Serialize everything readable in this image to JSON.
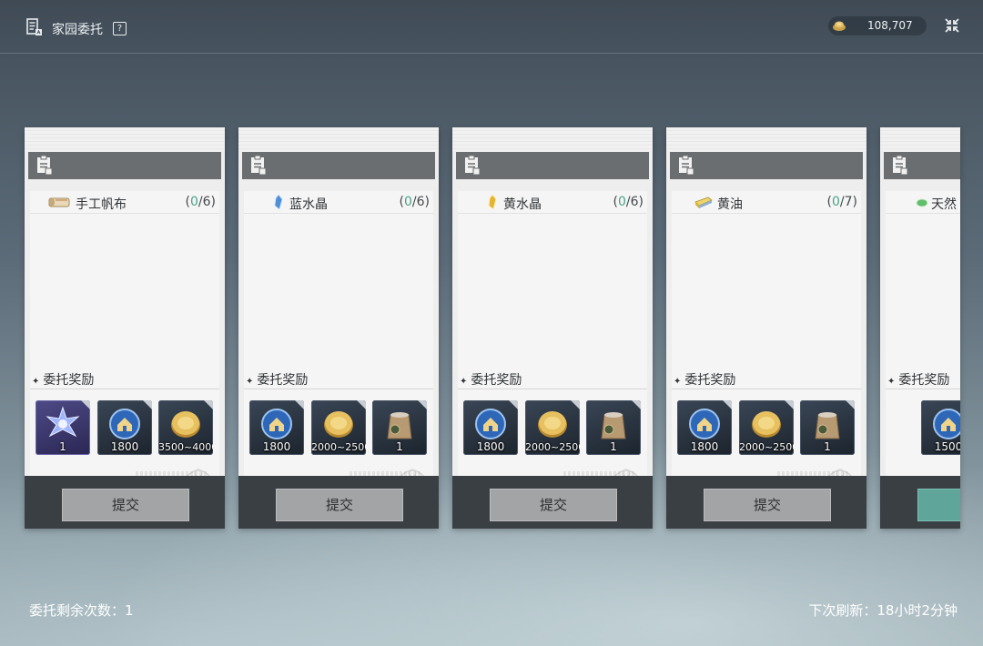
{
  "header": {
    "title": "家园委托",
    "help_icon": "question-icon",
    "currency": {
      "icon": "gold-ingot-icon",
      "value": "108,707"
    },
    "close_icon": "collapse-arrows-icon"
  },
  "cards": [
    {
      "material": {
        "name": "手工帆布",
        "icon": "canvas-roll-icon",
        "current": "0",
        "required": "/6)",
        "open": "("
      },
      "reward_title": "委托奖励",
      "rewards": [
        {
          "icon": "purple-crystal-star-icon",
          "qty": "1",
          "style": "purple"
        },
        {
          "icon": "blue-house-medal-icon",
          "qty": "1800",
          "style": "blue"
        },
        {
          "icon": "gold-coin-icon",
          "qty": "3500~4000",
          "style": "blue"
        }
      ],
      "submit_label": "提交"
    },
    {
      "material": {
        "name": "蓝水晶",
        "icon": "blue-crystal-icon",
        "current": "0",
        "required": "/6)",
        "open": "("
      },
      "reward_title": "委托奖励",
      "rewards": [
        {
          "icon": "blue-house-medal-icon",
          "qty": "1800",
          "style": "blue"
        },
        {
          "icon": "gold-coin-icon",
          "qty": "2000~2500",
          "style": "blue"
        },
        {
          "icon": "seed-sack-icon",
          "qty": "1",
          "style": "blue"
        }
      ],
      "submit_label": "提交"
    },
    {
      "material": {
        "name": "黄水晶",
        "icon": "yellow-crystal-icon",
        "current": "0",
        "required": "/6)",
        "open": "("
      },
      "reward_title": "委托奖励",
      "rewards": [
        {
          "icon": "blue-house-medal-icon",
          "qty": "1800",
          "style": "blue"
        },
        {
          "icon": "gold-coin-icon",
          "qty": "2000~2500",
          "style": "blue"
        },
        {
          "icon": "seed-sack-icon",
          "qty": "1",
          "style": "blue"
        }
      ],
      "submit_label": "提交"
    },
    {
      "material": {
        "name": "黄油",
        "icon": "butter-icon",
        "current": "0",
        "required": "/7)",
        "open": "("
      },
      "reward_title": "委托奖励",
      "rewards": [
        {
          "icon": "blue-house-medal-icon",
          "qty": "1800",
          "style": "blue"
        },
        {
          "icon": "gold-coin-icon",
          "qty": "2000~2500",
          "style": "blue"
        },
        {
          "icon": "seed-sack-icon",
          "qty": "1",
          "style": "blue"
        }
      ],
      "submit_label": "提交"
    },
    {
      "material": {
        "name": "天然",
        "icon": "green-leaf-icon",
        "current": "",
        "required": "",
        "open": ""
      },
      "reward_title": "委托奖励",
      "rewards": [
        {
          "icon": "blue-house-medal-icon",
          "qty": "1500",
          "style": "blue"
        }
      ],
      "submit_label": ""
    }
  ],
  "footer": {
    "remaining": "委托剩余次数：1",
    "refresh": "下次刷新：18小时2分钟"
  }
}
